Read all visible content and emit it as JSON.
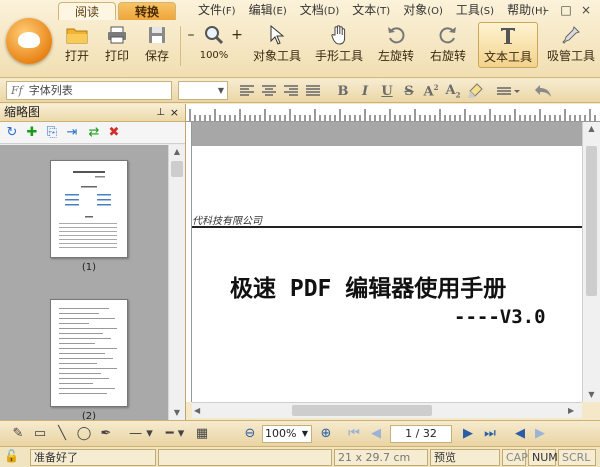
{
  "tabs": [
    {
      "label": "阅读",
      "active": false
    },
    {
      "label": "转换",
      "active": true
    }
  ],
  "menu": [
    {
      "label": "文件",
      "key": "(F)"
    },
    {
      "label": "编辑",
      "key": "(E)"
    },
    {
      "label": "文档",
      "key": "(D)"
    },
    {
      "label": "文本",
      "key": "(T)"
    },
    {
      "label": "对象",
      "key": "(O)"
    },
    {
      "label": "工具",
      "key": "(S)"
    },
    {
      "label": "帮助",
      "key": "(H)"
    }
  ],
  "window": {
    "minimize": "–",
    "maximize": "□",
    "close": "×"
  },
  "toolbar": {
    "open": "打开",
    "print": "打印",
    "save": "保存",
    "zoom_minus": "–",
    "zoom_plus": "+",
    "zoom_value": "100%",
    "object_tool": "对象工具",
    "hand_tool": "手形工具",
    "rotate_left": "左旋转",
    "rotate_right": "右旋转",
    "text_tool": "文本工具",
    "eyedropper_tool": "吸管工具"
  },
  "format": {
    "font_placeholder": "字体列表",
    "font_prefix": "Ff"
  },
  "thumbnails": {
    "title": "缩略图",
    "pages": [
      {
        "label": "(1)"
      },
      {
        "label": "(2)"
      }
    ]
  },
  "document": {
    "company": "代科技有限公司",
    "title": "极速 PDF 编辑器使用手册",
    "version": "----V3.0"
  },
  "bottom": {
    "zoom": "100%",
    "page": "1 / 32"
  },
  "status": {
    "ready": "准备好了",
    "page_size": "21 x 29.7 cm",
    "mode": "预览",
    "cap": "CAP",
    "num": "NUM",
    "scrl": "SCRL"
  },
  "colors": {
    "accent": "#eea53a",
    "ribbon": "#f1dfb2",
    "pdf_red": "#d32f2f"
  }
}
